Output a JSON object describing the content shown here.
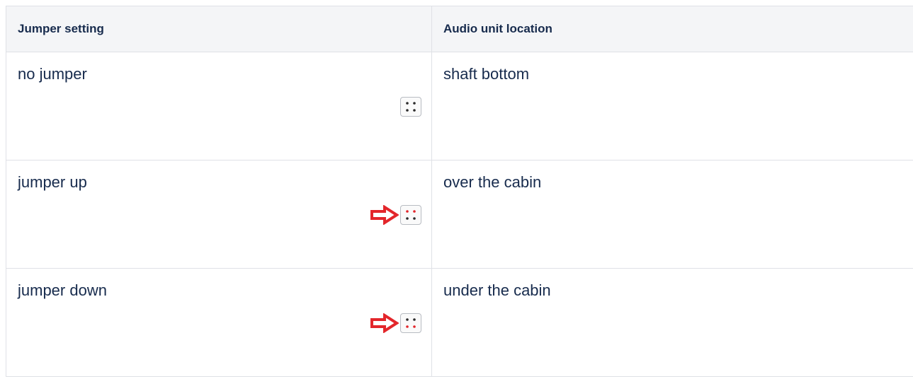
{
  "table": {
    "headers": {
      "jumper_setting": "Jumper setting",
      "audio_unit_location": "Audio unit location"
    },
    "rows": [
      {
        "setting": "no jumper",
        "location": "shaft bottom",
        "icon": "jumper-none-icon",
        "highlight_pins": "none"
      },
      {
        "setting": "jumper up",
        "location": "over the cabin",
        "icon": "jumper-up-icon",
        "highlight_pins": "top"
      },
      {
        "setting": "jumper down",
        "location": "under the cabin",
        "icon": "jumper-down-icon",
        "highlight_pins": "bottom"
      }
    ]
  },
  "colors": {
    "header_bg": "#f4f5f7",
    "border": "#dfe1e6",
    "text": "#172b4d",
    "arrow_red": "#e3262b",
    "pin_red": "#e3262b",
    "pin_black": "#2b2b2b"
  }
}
